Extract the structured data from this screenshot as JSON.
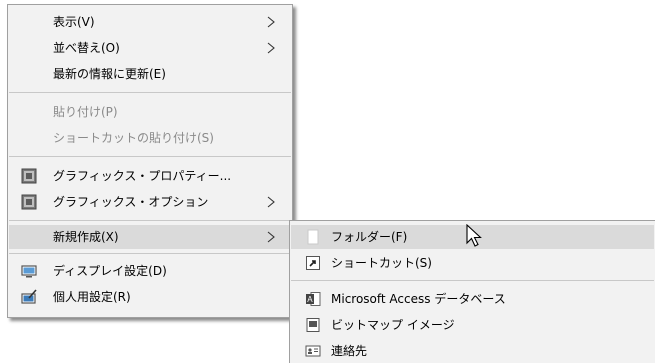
{
  "context_menu": {
    "items": [
      {
        "label": "表示(V)"
      },
      {
        "label": "並べ替え(O)"
      },
      {
        "label": "最新の情報に更新(E)"
      },
      {
        "label": "貼り付け(P)"
      },
      {
        "label": "ショートカットの貼り付け(S)"
      },
      {
        "label": "グラフィックス・プロパティー..."
      },
      {
        "label": "グラフィックス・オプション"
      },
      {
        "label": "新規作成(X)"
      },
      {
        "label": "ディスプレイ設定(D)"
      },
      {
        "label": "個人用設定(R)"
      }
    ]
  },
  "submenu": {
    "items": [
      {
        "label": "フォルダー(F)"
      },
      {
        "label": "ショートカット(S)"
      },
      {
        "label": "Microsoft Access データベース"
      },
      {
        "label": "ビットマップ イメージ"
      },
      {
        "label": "連絡先"
      }
    ]
  },
  "colors": {
    "menu_bg": "#f2f2f2",
    "highlight": "#dadada",
    "disabled_text": "#8a8a8a"
  }
}
